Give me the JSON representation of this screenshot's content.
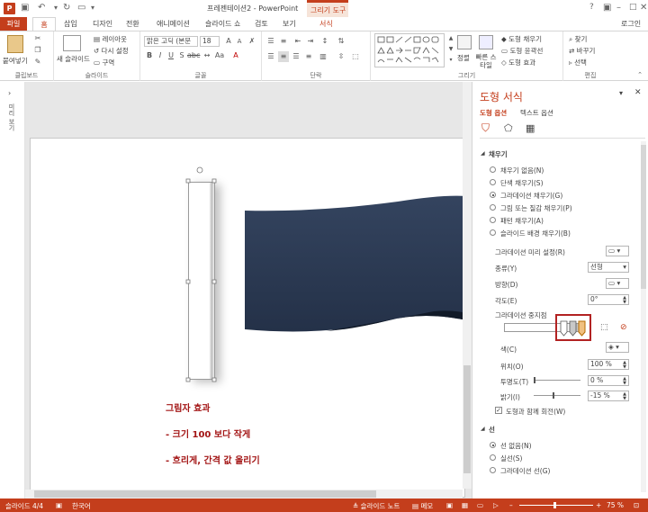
{
  "window": {
    "title": "프레젠테이션2 - PowerPoint",
    "context_tab_group": "그리기 도구",
    "user": "로그인"
  },
  "tabs": [
    {
      "label": "파일"
    },
    {
      "label": "홈"
    },
    {
      "label": "삽입"
    },
    {
      "label": "디자인"
    },
    {
      "label": "전환"
    },
    {
      "label": "애니메이션"
    },
    {
      "label": "슬라이드 쇼"
    },
    {
      "label": "검토"
    },
    {
      "label": "보기"
    },
    {
      "label": "서식"
    }
  ],
  "ribbon": {
    "clipboard": {
      "paste": "붙여넣기",
      "group": "클립보드"
    },
    "slides": {
      "new_slide": "새 슬라이드",
      "layout": "레이아웃",
      "reset": "다시 설정",
      "section": "구역",
      "group": "슬라이드"
    },
    "font": {
      "name": "맑은 고딕 (본문",
      "size": "18",
      "group": "글꼴"
    },
    "paragraph": {
      "group": "단락"
    },
    "drawing": {
      "arrange": "정렬",
      "quick_styles": "빠른 스타일",
      "fill": "도형 채우기",
      "outline": "도형 윤곽선",
      "effects": "도형 효과",
      "group": "그리기"
    },
    "editing": {
      "find": "찾기",
      "replace": "바꾸기",
      "select": "선택",
      "group": "편집"
    }
  },
  "left_strip": {
    "label": "미리 보기"
  },
  "slide": {
    "notes": [
      "그림자 효과",
      "- 크기 100 보다 작게",
      "- 흐리게, 간격 값 올리기"
    ]
  },
  "pane": {
    "title": "도형 서식",
    "tab_shape": "도형 옵션",
    "tab_text": "텍스트 옵션",
    "fill_section": "채우기",
    "fill_options": [
      {
        "label": "채우기 없음(N)",
        "selected": false
      },
      {
        "label": "단색 채우기(S)",
        "selected": false
      },
      {
        "label": "그라데이션 채우기(G)",
        "selected": true
      },
      {
        "label": "그림 또는 질감 채우기(P)",
        "selected": false
      },
      {
        "label": "패턴 채우기(A)",
        "selected": false
      },
      {
        "label": "슬라이드 배경 채우기(B)",
        "selected": false
      }
    ],
    "preset_label": "그라데이션 미리 설정(R)",
    "type_label": "종류(Y)",
    "type_value": "선형",
    "direction_label": "방향(D)",
    "angle_label": "각도(E)",
    "angle_value": "0°",
    "stops_label": "그라데이션 중지점",
    "color_label": "색(C)",
    "position_label": "위치(O)",
    "position_value": "100 %",
    "transparency_label": "투명도(T)",
    "transparency_value": "0 %",
    "transparency_level": 0,
    "brightness_label": "밝기(I)",
    "brightness_value": "-15 %",
    "brightness_level": -15,
    "rotate_label": "도형과 함께 회전(W)",
    "line_section": "선",
    "line_options": [
      {
        "label": "선 없음(N)",
        "selected": true
      },
      {
        "label": "실선(S)",
        "selected": false
      },
      {
        "label": "그라데이션 선(G)",
        "selected": false
      }
    ]
  },
  "status": {
    "slide": "슬라이드 4/4",
    "language": "한국어",
    "notes": "슬라이드 노트",
    "comments": "메모",
    "zoom": "75 %"
  },
  "colors": {
    "accent": "#c43e1c",
    "shape_fill": "#2b3a52",
    "note_text": "#a31515",
    "highlight_box": "#b22222"
  }
}
